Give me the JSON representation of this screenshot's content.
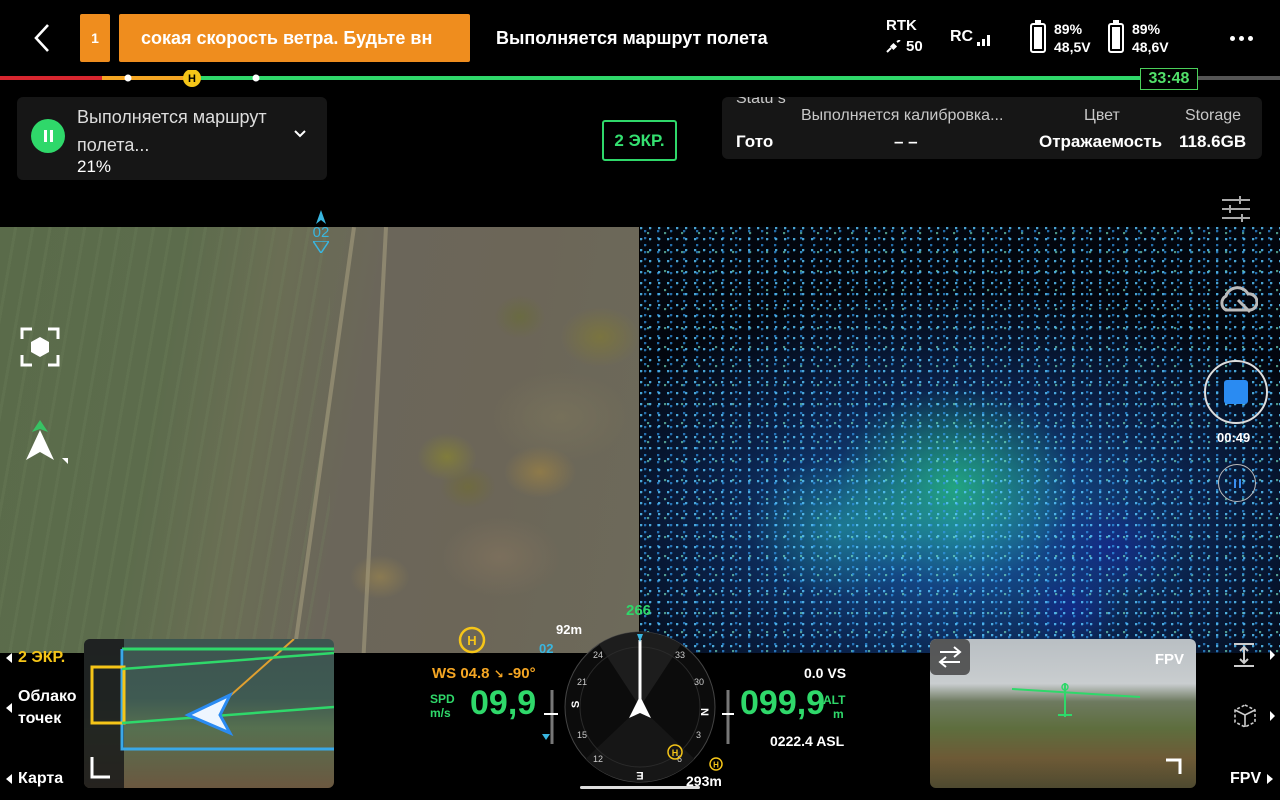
{
  "topbar": {
    "warning_count": "1",
    "warning_text": "сокая скорость ветра. Будьте вн",
    "flight_status": "Выполняется маршрут полета",
    "rtk_label": "RTK",
    "rtk_sats": "50",
    "rc_label": "RC",
    "battery1": {
      "percent": "89%",
      "voltage": "48,5V"
    },
    "battery2": {
      "percent": "89%",
      "voltage": "48,6V"
    },
    "timer": "33:48"
  },
  "mission": {
    "title": "Выполняется маршрут полета...",
    "progress": "21%"
  },
  "screen_toggle": "2 ЭКР.",
  "info_panel": {
    "status_label": "Statu s",
    "status_value": "Гото",
    "calibration_label": "Выполняется калибровка...",
    "calibration_value": "– –",
    "color_label": "Цвет",
    "color_value": "Отражаемость",
    "storage_label": "Storage",
    "storage_value": "118.6GB"
  },
  "map": {
    "waypoint_label": "02"
  },
  "recording": {
    "time": "00:49"
  },
  "bottom": {
    "left_links": [
      "2 ЭКР.",
      "Облако точек",
      "Карта"
    ],
    "right_link": "FPV",
    "fpv_thumb_label": "FPV",
    "wind": "WS 04.8",
    "wind_dir": "-90°",
    "spd_label": "SPD",
    "spd_unit": "m/s",
    "speed": "09,9",
    "alt_label": "ALT",
    "alt_unit": "m",
    "altitude": "099,9",
    "vs": "0.0 VS",
    "asl": "0222.4 ASL",
    "heading": "266",
    "dist_top": "92m",
    "wp_small": "02",
    "dist_bottom": "293m",
    "home_label": "H",
    "compass": {
      "s": "S",
      "w": "W",
      "n": "N",
      "e": "E",
      "t33": "33",
      "t30": "30",
      "t24": "24",
      "t21": "21",
      "t15": "15",
      "t12": "12",
      "t6": "6",
      "t3": "3"
    }
  },
  "colors": {
    "warning": "#ef8d1e",
    "accent_green": "#2fd86a",
    "route_orange": "#f5a623",
    "record_blue": "#2a8bf2"
  }
}
